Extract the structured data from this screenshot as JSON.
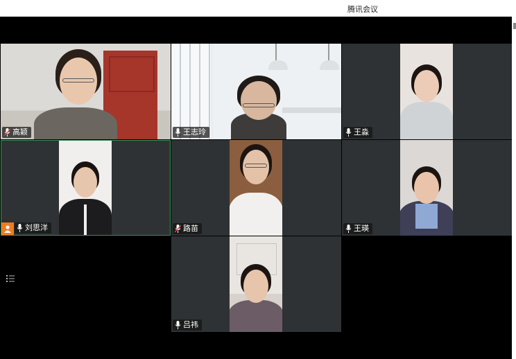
{
  "app": {
    "title": "腾讯会议"
  },
  "participants": [
    {
      "name": "高颖"
    },
    {
      "name": "王志玲"
    },
    {
      "name": "王淼"
    },
    {
      "name": "刘思洋"
    },
    {
      "name": "路苗"
    },
    {
      "name": "王瑛"
    },
    {
      "name": "吕祎"
    }
  ],
  "colors": {
    "window_bg": "#000000",
    "tile_bg": "#2f3235",
    "speaking_border": "#3a8f57",
    "host_badge": "#f07b1f"
  },
  "icons": [
    "mic-icon",
    "host-icon",
    "list-icon"
  ]
}
